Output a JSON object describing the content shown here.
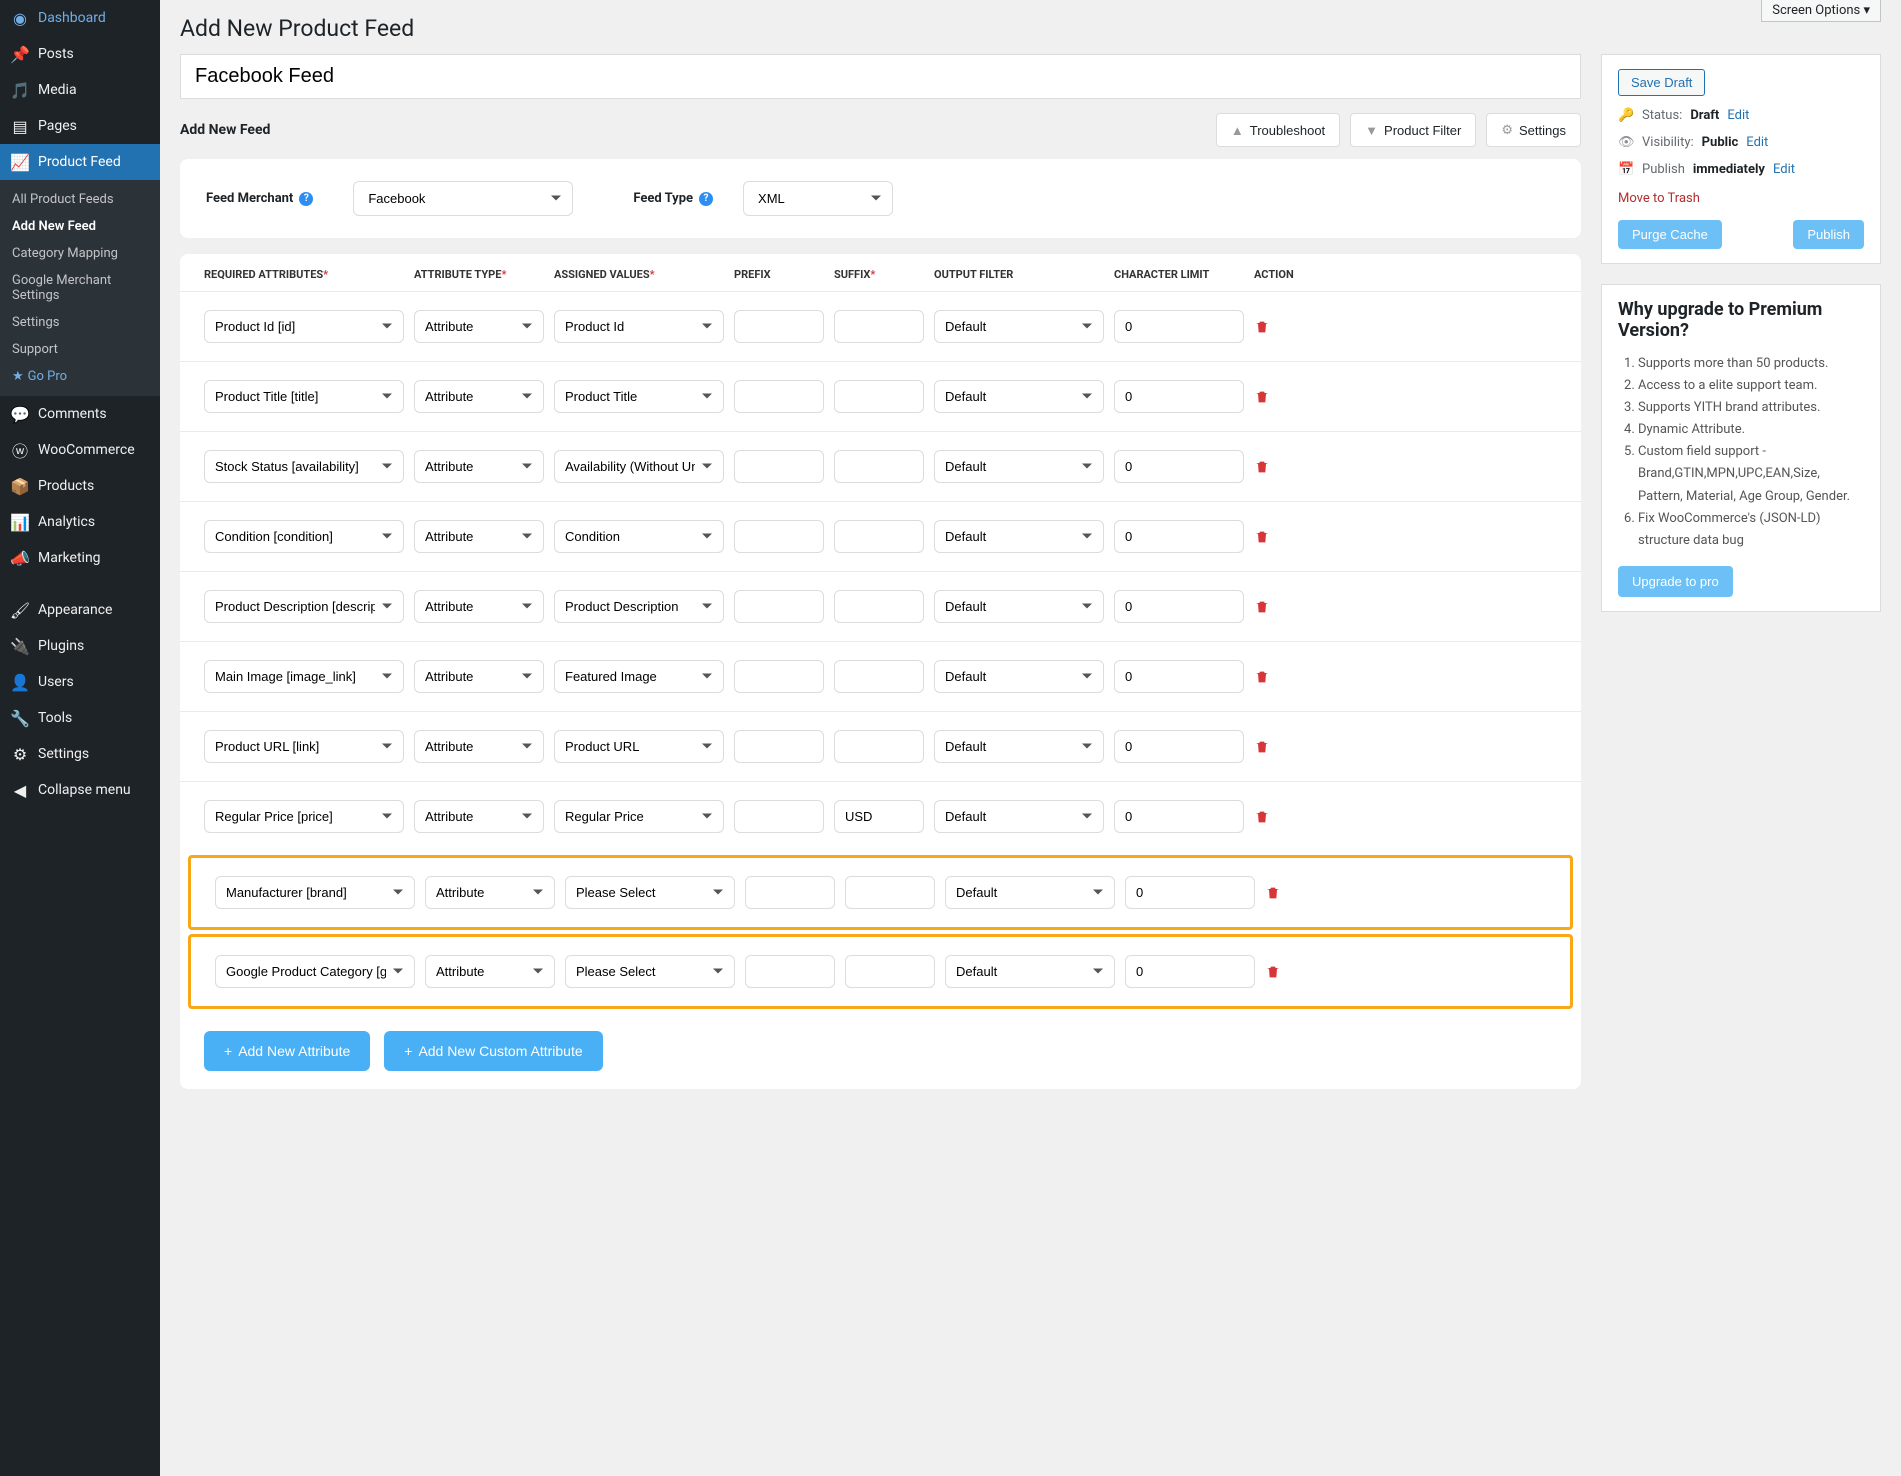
{
  "screen_options": "Screen Options",
  "page_title": "Add New Product Feed",
  "feed_title": "Facebook Feed",
  "section_heading": "Add New Feed",
  "top_buttons": {
    "troubleshoot": "Troubleshoot",
    "product_filter": "Product Filter",
    "settings": "Settings"
  },
  "merchant": {
    "label": "Feed Merchant",
    "value": "Facebook"
  },
  "feed_type": {
    "label": "Feed Type",
    "value": "XML"
  },
  "table_headers": {
    "required_attrs": "REQUIRED ATTRIBUTES",
    "attr_type": "ATTRIBUTE TYPE",
    "assigned": "ASSIGNED VALUES",
    "prefix": "PREFIX",
    "suffix": "SUFFIX",
    "output_filter": "OUTPUT FILTER",
    "char_limit": "CHARACTER LIMIT",
    "action": "ACTION"
  },
  "rows": [
    {
      "attr": "Product Id [id]",
      "type": "Attribute",
      "assigned": "Product Id",
      "prefix": "",
      "suffix": "",
      "filter": "Default",
      "limit": "0",
      "hl": false
    },
    {
      "attr": "Product Title [title]",
      "type": "Attribute",
      "assigned": "Product Title",
      "prefix": "",
      "suffix": "",
      "filter": "Default",
      "limit": "0",
      "hl": false
    },
    {
      "attr": "Stock Status [availability]",
      "type": "Attribute",
      "assigned": "Availability (Without Underscore)",
      "prefix": "",
      "suffix": "",
      "filter": "Default",
      "limit": "0",
      "hl": false
    },
    {
      "attr": "Condition [condition]",
      "type": "Attribute",
      "assigned": "Condition",
      "prefix": "",
      "suffix": "",
      "filter": "Default",
      "limit": "0",
      "hl": false
    },
    {
      "attr": "Product Description [description]",
      "type": "Attribute",
      "assigned": "Product Description",
      "prefix": "",
      "suffix": "",
      "filter": "Default",
      "limit": "0",
      "hl": false
    },
    {
      "attr": "Main Image [image_link]",
      "type": "Attribute",
      "assigned": "Featured Image",
      "prefix": "",
      "suffix": "",
      "filter": "Default",
      "limit": "0",
      "hl": false
    },
    {
      "attr": "Product URL [link]",
      "type": "Attribute",
      "assigned": "Product URL",
      "prefix": "",
      "suffix": "",
      "filter": "Default",
      "limit": "0",
      "hl": false
    },
    {
      "attr": "Regular Price [price]",
      "type": "Attribute",
      "assigned": "Regular Price",
      "prefix": "",
      "suffix": "USD",
      "filter": "Default",
      "limit": "0",
      "hl": false
    },
    {
      "attr": "Manufacturer [brand]",
      "type": "Attribute",
      "assigned": "Please Select",
      "prefix": "",
      "suffix": "",
      "filter": "Default",
      "limit": "0",
      "hl": true
    },
    {
      "attr": "Google Product Category [google_product_category]",
      "type": "Attribute",
      "assigned": "Please Select",
      "prefix": "",
      "suffix": "",
      "filter": "Default",
      "limit": "0",
      "hl": true
    }
  ],
  "bottom_buttons": {
    "add_attr": "Add New Attribute",
    "add_custom": "Add New Custom Attribute"
  },
  "sidebar": {
    "dashboard": "Dashboard",
    "posts": "Posts",
    "media": "Media",
    "pages": "Pages",
    "product_feed": "Product Feed",
    "submenu": {
      "all": "All Product Feeds",
      "add": "Add New Feed",
      "category": "Category Mapping",
      "google": "Google Merchant Settings",
      "settings": "Settings",
      "support": "Support",
      "gopro": "Go Pro"
    },
    "comments": "Comments",
    "woo": "WooCommerce",
    "products": "Products",
    "analytics": "Analytics",
    "marketing": "Marketing",
    "appearance": "Appearance",
    "plugins": "Plugins",
    "users": "Users",
    "tools": "Tools",
    "settings": "Settings",
    "collapse": "Collapse menu"
  },
  "publish_box": {
    "save_draft": "Save Draft",
    "status_label": "Status:",
    "status_val": "Draft",
    "edit": "Edit",
    "visibility_label": "Visibility:",
    "visibility_val": "Public",
    "publish_label": "Publish",
    "publish_val": "immediately",
    "trash": "Move to Trash",
    "purge": "Purge Cache",
    "publish_btn": "Publish"
  },
  "upgrade": {
    "title": "Why upgrade to Premium Version?",
    "items": [
      "Supports more than 50 products.",
      "Access to a elite support team.",
      "Supports YITH brand attributes.",
      "Dynamic Attribute.",
      "Custom field support - Brand,GTIN,MPN,UPC,EAN,Size, Pattern, Material, Age Group, Gender.",
      "Fix WooCommerce's (JSON-LD) structure data bug"
    ],
    "btn": "Upgrade to pro"
  }
}
